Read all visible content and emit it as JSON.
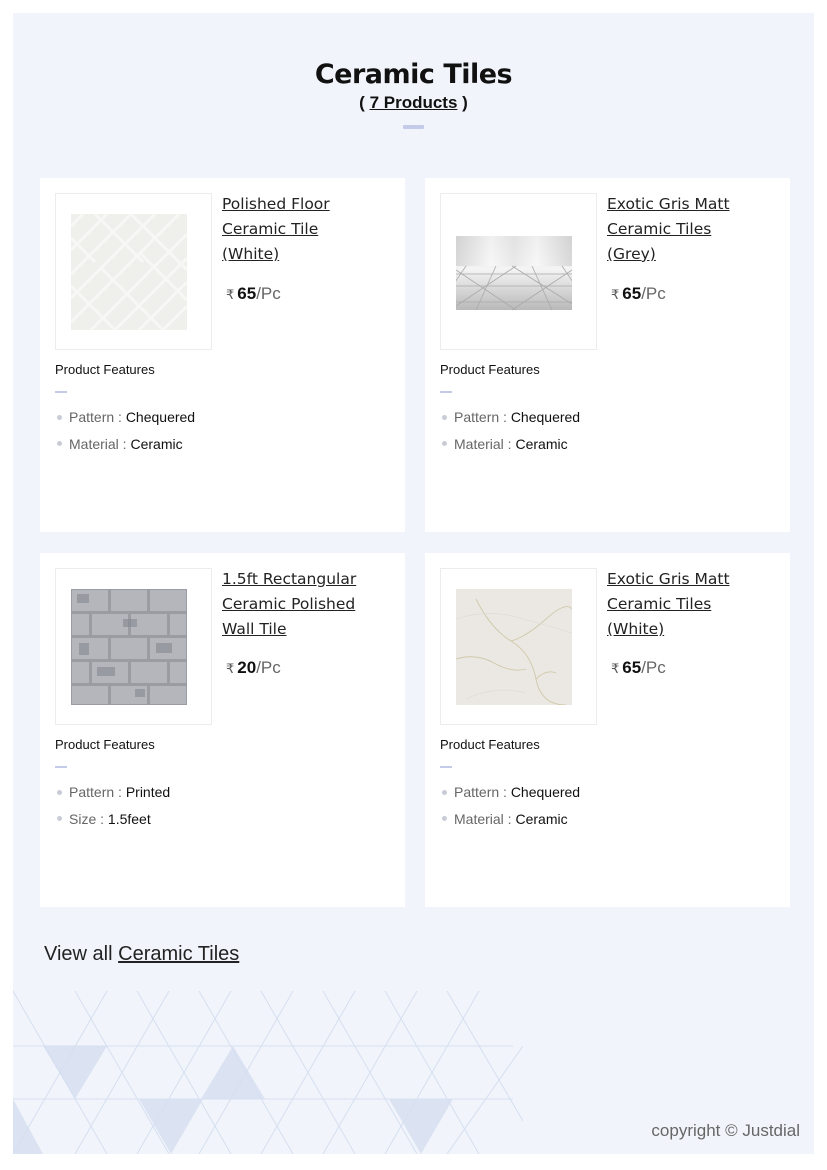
{
  "header": {
    "title": "Ceramic Tiles",
    "count_open": "( ",
    "count_num": "7 Products",
    "count_close": " )"
  },
  "cards": [
    {
      "name": "Polished Floor Ceramic Tile (White)",
      "currency": "₹",
      "price": "65",
      "unit": "/Pc",
      "features_title": "Product Features",
      "features": [
        {
          "key": "Pattern : ",
          "value": "Chequered"
        },
        {
          "key": "Material : ",
          "value": "Ceramic"
        }
      ],
      "image": "white-tile-image"
    },
    {
      "name": "Exotic Gris Matt Ceramic Tiles (Grey)",
      "currency": "₹",
      "price": "65",
      "unit": "/Pc",
      "features_title": "Product Features",
      "features": [
        {
          "key": "Pattern : ",
          "value": "Chequered"
        },
        {
          "key": "Material : ",
          "value": "Ceramic"
        }
      ],
      "image": "grey-floor-image"
    },
    {
      "name": "1.5ft Rectangular Ceramic Polished Wall Tile",
      "currency": "₹",
      "price": "20",
      "unit": "/Pc",
      "features_title": "Product Features",
      "features": [
        {
          "key": "Pattern : ",
          "value": "Printed"
        },
        {
          "key": "Size : ",
          "value": "1.5feet"
        }
      ],
      "image": "brick-tile-image"
    },
    {
      "name": "Exotic Gris Matt Ceramic Tiles (White)",
      "currency": "₹",
      "price": "65",
      "unit": "/Pc",
      "features_title": "Product Features",
      "features": [
        {
          "key": "Pattern : ",
          "value": "Chequered"
        },
        {
          "key": "Material : ",
          "value": "Ceramic"
        }
      ],
      "image": "marble-tile-image"
    }
  ],
  "footer": {
    "viewall_prefix": "View all ",
    "viewall_link": "Ceramic Tiles",
    "copyright": "copyright © Justdial"
  },
  "colors": {
    "page_bg": "#f1f5fb",
    "accent_line": "#c4cbe9",
    "pattern_line": "#d6dff0",
    "pattern_fill": "#dbe3f3"
  }
}
